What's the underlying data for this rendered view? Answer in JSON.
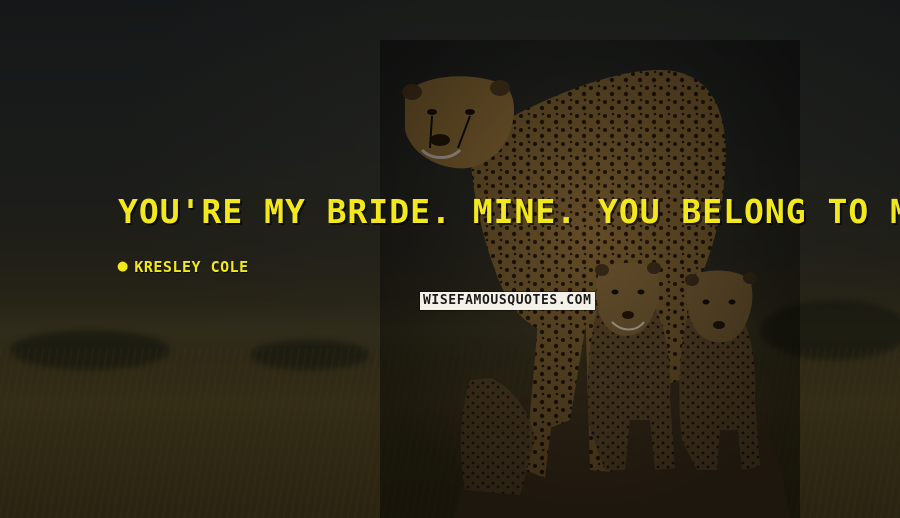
{
  "quote": {
    "text": "You're my bride. Mine. You belong to me.",
    "author": "Kresley Cole"
  },
  "watermark": {
    "text": "wisefamousquotes.com"
  },
  "icons": {
    "author_marker": "quote-mark-icon"
  },
  "colors": {
    "quote_text": "#f3e81b",
    "watermark_bg": "#f3f1e8",
    "watermark_text": "#1b1b1b"
  }
}
